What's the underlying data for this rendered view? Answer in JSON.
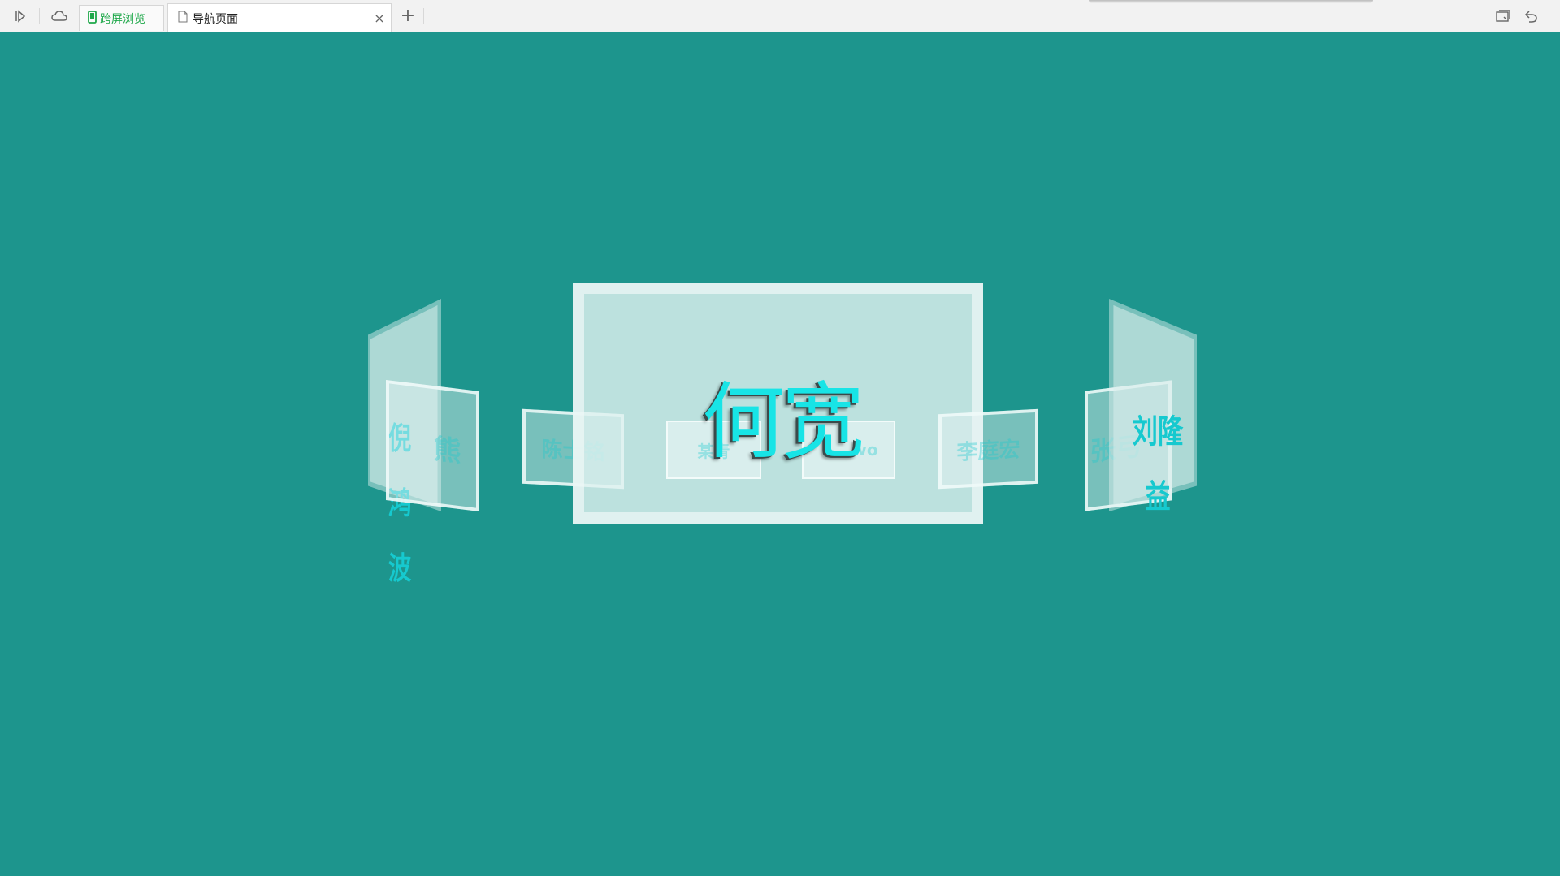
{
  "toolbar": {
    "cross_screen_label": "跨屏浏览",
    "tab_title": "导航页面",
    "close_symbol": "×",
    "new_tab_symbol": "+",
    "icons": [
      "play-forward-icon",
      "cloud-icon",
      "phone-icon",
      "document-icon",
      "screen-cast-icon",
      "undo-icon"
    ]
  },
  "carousel": {
    "center_name": "何宽",
    "left_outer_name": "倪鸿波",
    "left_inner_name": "熊",
    "left_mid_name": "陈士铭",
    "center_left_name": "某青",
    "center_right_name": "wo",
    "right_mid_name": "李庭宏",
    "right_inner_name": "张弓",
    "right_outer_name": "刘隆益"
  },
  "colors": {
    "background": "#1d958d",
    "accent_text": "#18e4e6",
    "tab_green": "#1fa84a"
  }
}
